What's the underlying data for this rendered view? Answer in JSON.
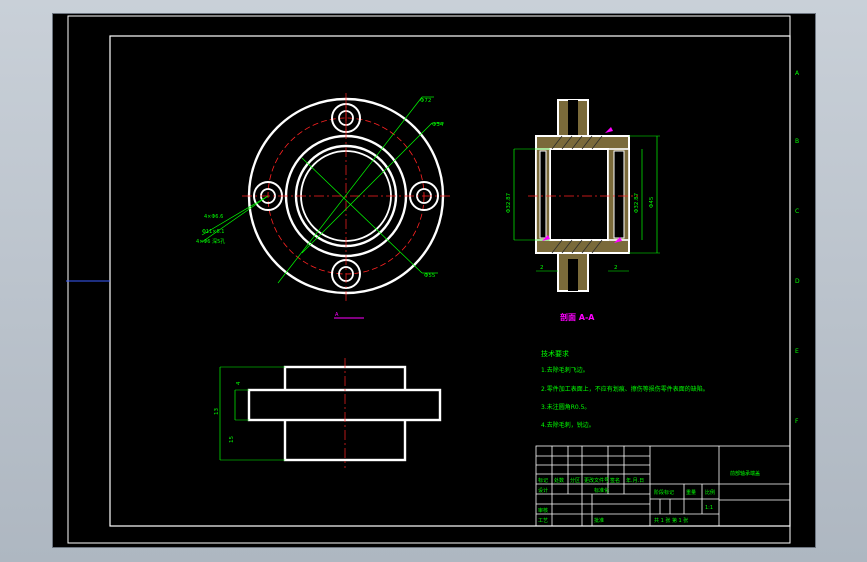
{
  "drawing": {
    "dim_left_top": "Φ72",
    "dim_left_mid": "Φ34",
    "dim_left_bottom": "Φ55",
    "dim_hole_a": "4×Φ6.6",
    "dim_hole_b": "Φ11×6.1",
    "dim_hole_c": "4×Φ6 深5孔",
    "section_label": "剖面 A-A",
    "section_marker": "A",
    "dim_sec_left": "Φ32.87",
    "dim_sec_mid": "Φ32.87",
    "dim_sec_right": "Φ45",
    "dim_sec_b1": "2",
    "dim_sec_b2": "2",
    "dim_front_a": "4",
    "dim_front_b": "13",
    "dim_front_c": "15"
  },
  "notes": {
    "title": "技术要求",
    "items": [
      "1.去除毛刺飞边。",
      "2.零件加工表面上，不应有划痕、擦伤等损伤零件表面的缺陷。",
      "3.未注圆角R0.5。",
      "4.去除毛刺，锐边。"
    ]
  },
  "title_block": {
    "part_name": "前部轴承端盖",
    "cells": {
      "biaoji": "标记",
      "chushu": "处数",
      "fenqu": "分区",
      "gengai": "更改文件号",
      "qianming": "签名",
      "nianyueri": "年.月.日",
      "sheji": "设计",
      "biaozhunhua": "标准化",
      "jieduan": "阶段标记",
      "zhongliang": "重量",
      "bili": "比例",
      "bili_value": "1:1",
      "shenhe": "审核",
      "gongyi": "工艺",
      "pizhun": "批准",
      "sheet": "共 1 张  第 1 张"
    }
  },
  "border": {
    "right_labels": [
      "A",
      "B",
      "C",
      "D",
      "E",
      "F"
    ]
  }
}
